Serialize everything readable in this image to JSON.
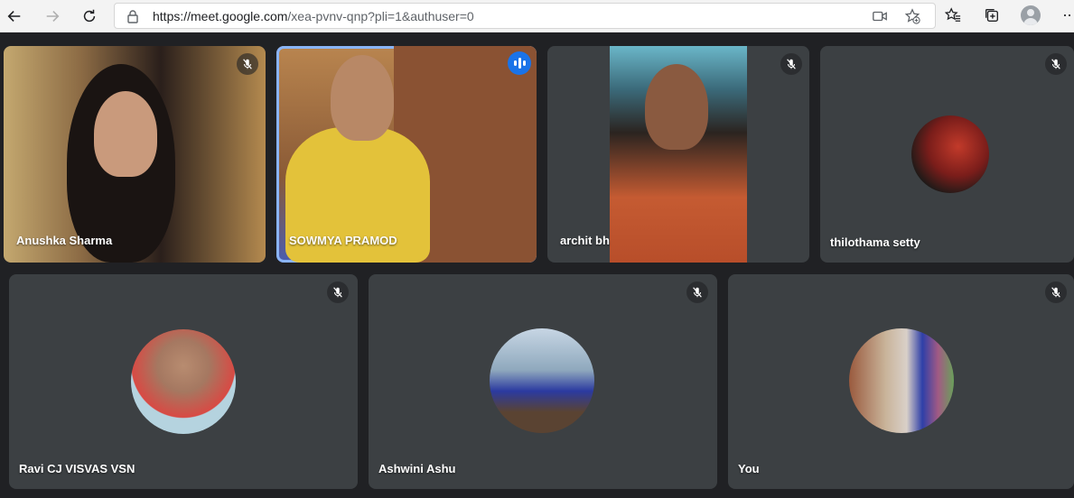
{
  "browser": {
    "url_host": "https://meet.google.com",
    "url_path": "/xea-pvnv-qnp?pli=1&authuser=0",
    "more_label": "··"
  },
  "participants": [
    {
      "name": "Anushka Sharma",
      "muted": true,
      "speaking": false,
      "type": "video"
    },
    {
      "name": "SOWMYA PRAMOD",
      "muted": false,
      "speaking": true,
      "type": "video"
    },
    {
      "name": "archit bh",
      "muted": true,
      "speaking": false,
      "type": "video"
    },
    {
      "name": "thilothama setty",
      "muted": true,
      "speaking": false,
      "type": "avatar"
    },
    {
      "name": "Ravi CJ VISVAS VSN",
      "muted": true,
      "speaking": false,
      "type": "avatar"
    },
    {
      "name": "Ashwini Ashu",
      "muted": true,
      "speaking": false,
      "type": "avatar"
    },
    {
      "name": "You",
      "muted": true,
      "speaking": false,
      "type": "avatar"
    }
  ],
  "colors": {
    "background": "#202124",
    "tile": "#3c4043",
    "speaking_outline": "#8ab4f8",
    "speaking_indicator": "#1a73e8"
  },
  "icons": [
    "back-icon",
    "forward-icon",
    "refresh-icon",
    "lock-icon",
    "camera-icon",
    "add-favorite-icon",
    "favorites-icon",
    "collections-icon",
    "profile-icon",
    "mic-off-icon",
    "audio-level-icon"
  ]
}
